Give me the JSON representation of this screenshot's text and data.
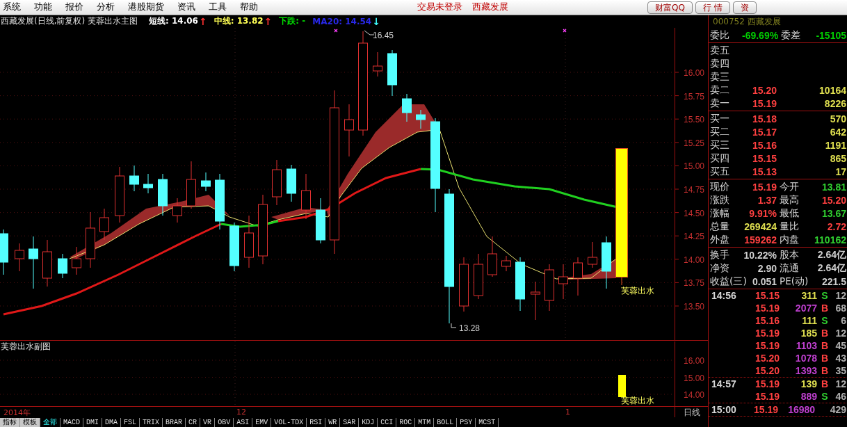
{
  "menu": {
    "items": [
      "系统",
      "功能",
      "报价",
      "分析",
      "港股期货",
      "资讯",
      "工具",
      "帮助"
    ],
    "status": [
      "交易未登录",
      "西藏发展"
    ],
    "buttons": [
      "财富QQ",
      "行 情",
      "资"
    ]
  },
  "main_chart": {
    "title": "西藏发展(日线,前复权) 芙蓉出水主图",
    "legend": [
      {
        "text": "短线: 14.06",
        "color": "#ffffff",
        "arrow": {
          "text": "↑",
          "color": "#ff3030"
        }
      },
      {
        "text": "中线: 13.82",
        "color": "#ffff54",
        "arrow": {
          "text": "↑",
          "color": "#ff3030"
        }
      },
      {
        "text": "下跌: -",
        "color": "#00e000"
      },
      {
        "text": "MA20: 14.54",
        "color": "#2828e8",
        "arrow": {
          "text": "↓",
          "color": "#40ffff"
        }
      }
    ],
    "y_axis": [
      "16.00",
      "15.75",
      "15.50",
      "15.25",
      "15.00",
      "14.75",
      "14.50",
      "14.25",
      "14.00",
      "13.75",
      "13.50"
    ],
    "annotations": [
      "16.45",
      "13.28"
    ],
    "signal_label": "芙蓉出水"
  },
  "sub_chart": {
    "title": "芙蓉出水副图",
    "y_axis": [
      "16.00",
      "15.00",
      "14.00"
    ],
    "signal_label": "芙蓉出水"
  },
  "x_axis": {
    "labels": [
      "2014年",
      "12",
      "1"
    ],
    "period": "日线"
  },
  "indicator_tabs": [
    {
      "label": "指标",
      "kind": "mode",
      "selected": false
    },
    {
      "label": "模板",
      "kind": "mode",
      "selected": false
    },
    {
      "label": "全部",
      "kind": "indicator",
      "selected": true
    },
    {
      "label": "MACD",
      "kind": "indicator",
      "selected": false
    },
    {
      "label": "DMI",
      "kind": "indicator",
      "selected": false
    },
    {
      "label": "DMA",
      "kind": "indicator",
      "selected": false
    },
    {
      "label": "FSL",
      "kind": "indicator",
      "selected": false
    },
    {
      "label": "TRIX",
      "kind": "indicator",
      "selected": false
    },
    {
      "label": "BRAR",
      "kind": "indicator",
      "selected": false
    },
    {
      "label": "CR",
      "kind": "indicator",
      "selected": false
    },
    {
      "label": "VR",
      "kind": "indicator",
      "selected": false
    },
    {
      "label": "OBV",
      "kind": "indicator",
      "selected": false
    },
    {
      "label": "ASI",
      "kind": "indicator",
      "selected": false
    },
    {
      "label": "EMV",
      "kind": "indicator",
      "selected": false
    },
    {
      "label": "VOL-TDX",
      "kind": "indicator",
      "selected": false
    },
    {
      "label": "RSI",
      "kind": "indicator",
      "selected": false
    },
    {
      "label": "WR",
      "kind": "indicator",
      "selected": false
    },
    {
      "label": "SAR",
      "kind": "indicator",
      "selected": false
    },
    {
      "label": "KDJ",
      "kind": "indicator",
      "selected": false
    },
    {
      "label": "CCI",
      "kind": "indicator",
      "selected": false
    },
    {
      "label": "ROC",
      "kind": "indicator",
      "selected": false
    },
    {
      "label": "MTM",
      "kind": "indicator",
      "selected": false
    },
    {
      "label": "BOLL",
      "kind": "indicator",
      "selected": false
    },
    {
      "label": "PSY",
      "kind": "indicator",
      "selected": false
    },
    {
      "label": "MCST",
      "kind": "indicator",
      "selected": false
    }
  ],
  "quote_panel": {
    "title": "000752 西藏发展",
    "ratio": [
      {
        "label": "委比",
        "value": "-69.69%",
        "color": "#00d000"
      },
      {
        "label": "委差",
        "value": "-15105",
        "color": "#00d000"
      }
    ],
    "sell": [
      {
        "label": "卖五"
      },
      {
        "label": "卖四"
      },
      {
        "label": "卖三"
      },
      {
        "label": "卖二",
        "price": "15.20",
        "volume": "10164"
      },
      {
        "label": "卖一",
        "price": "15.19",
        "volume": "8226"
      }
    ],
    "buy": [
      {
        "label": "买一",
        "price": "15.18",
        "volume": "570"
      },
      {
        "label": "买二",
        "price": "15.17",
        "volume": "642"
      },
      {
        "label": "买三",
        "price": "15.16",
        "volume": "1191"
      },
      {
        "label": "买四",
        "price": "15.15",
        "volume": "865"
      },
      {
        "label": "买五",
        "price": "15.13",
        "volume": "17"
      }
    ],
    "stats": [
      [
        {
          "label": "现价",
          "value": "15.19",
          "color": "#ff4040"
        },
        {
          "label": "今开",
          "value": "13.81",
          "color": "#30d030"
        }
      ],
      [
        {
          "label": "涨跌",
          "value": "1.37",
          "color": "#ff4040"
        },
        {
          "label": "最高",
          "value": "15.20",
          "color": "#ff4040"
        }
      ],
      [
        {
          "label": "涨幅",
          "value": "9.91%",
          "color": "#ff4040"
        },
        {
          "label": "最低",
          "value": "13.67",
          "color": "#30d030"
        }
      ],
      [
        {
          "label": "总量",
          "value": "269424",
          "color": "#e0e050"
        },
        {
          "label": "量比",
          "value": "2.72",
          "color": "#ff4040"
        }
      ],
      [
        {
          "label": "外盘",
          "value": "159262",
          "color": "#ff4040"
        },
        {
          "label": "内盘",
          "value": "110162",
          "color": "#30d030"
        }
      ]
    ],
    "finance": [
      [
        {
          "label": "换手",
          "value": "10.22%",
          "color": "#d0d0d0"
        },
        {
          "label": "股本",
          "value": "2.64亿",
          "color": "#d0d0d0"
        }
      ],
      [
        {
          "label": "净资",
          "value": "2.90",
          "color": "#d0d0d0"
        },
        {
          "label": "流通",
          "value": "2.64亿",
          "color": "#d0d0d0"
        }
      ],
      [
        {
          "label": "收益(三)",
          "value": "0.051",
          "color": "#d0d0d0"
        },
        {
          "label": "PE(动)",
          "value": "221.5",
          "color": "#d0d0d0"
        }
      ]
    ],
    "ticks": [
      {
        "time": "14:56",
        "rows": [
          {
            "price": "15.15",
            "volume": "311",
            "color": "#e0e050",
            "kind": "sell",
            "side": "S",
            "count": "12"
          },
          {
            "price": "15.19",
            "volume": "2077",
            "color": "#c040d0",
            "kind": "buy",
            "side": "B",
            "count": "68"
          },
          {
            "price": "15.16",
            "volume": "111",
            "color": "#e0e050",
            "kind": "sell",
            "side": "S",
            "count": "6"
          },
          {
            "price": "15.19",
            "volume": "185",
            "color": "#e0e050",
            "kind": "buy",
            "side": "B",
            "count": "12"
          },
          {
            "price": "15.19",
            "volume": "1103",
            "color": "#c040d0",
            "kind": "buy",
            "side": "B",
            "count": "45"
          },
          {
            "price": "15.20",
            "volume": "1078",
            "color": "#c040d0",
            "kind": "buy",
            "side": "B",
            "count": "43"
          },
          {
            "price": "15.20",
            "volume": "1393",
            "color": "#c040d0",
            "kind": "buy",
            "side": "B",
            "count": "35"
          }
        ]
      },
      {
        "time": "14:57",
        "rows": [
          {
            "price": "15.19",
            "volume": "139",
            "color": "#e0e050",
            "kind": "buy",
            "side": "B",
            "count": "12"
          },
          {
            "price": "15.19",
            "volume": "889",
            "color": "#c040d0",
            "kind": "sell",
            "side": "S",
            "count": "46"
          }
        ]
      },
      {
        "time": "15:00",
        "rows": [
          {
            "price": "15.19",
            "volume": "16980",
            "color": "#c040d0",
            "kind": "none",
            "count": "429"
          }
        ]
      }
    ]
  }
}
